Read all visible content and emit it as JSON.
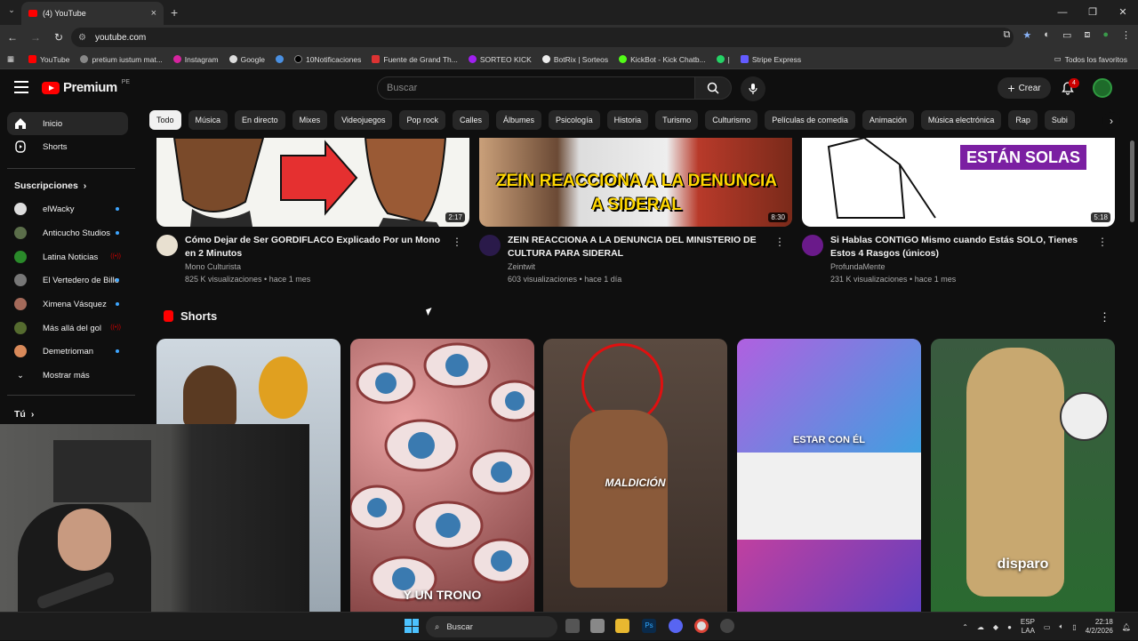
{
  "browser": {
    "tab_title": "(4) YouTube",
    "url": "youtube.com",
    "bookmarks": [
      "YouTube",
      "pretium iustum mat...",
      "Instagram",
      "Google",
      "",
      "10Notificaciones",
      "Fuente de Grand Th...",
      "SORTEO KICK",
      "BotRix | Sorteos",
      "KickBot - Kick Chatb...",
      "|",
      "Stripe Express"
    ],
    "all_bookmarks": "Todos los favoritos"
  },
  "header": {
    "logo_text": "Premium",
    "logo_region": "PE",
    "search_placeholder": "Buscar",
    "create_label": "Crear",
    "notif_count": "4"
  },
  "sidebar": {
    "home": "Inicio",
    "shorts": "Shorts",
    "subs_title": "Suscripciones",
    "channels": [
      {
        "name": "elWacky",
        "status": "new"
      },
      {
        "name": "Anticucho Studios",
        "status": "new"
      },
      {
        "name": "Latina Noticias",
        "status": "live"
      },
      {
        "name": "El Vertedero de Billo",
        "status": "new"
      },
      {
        "name": "Ximena Vásquez",
        "status": "new"
      },
      {
        "name": "Más allá del gol",
        "status": "live"
      },
      {
        "name": "Demetrioman",
        "status": "new"
      }
    ],
    "show_more": "Mostrar más",
    "you_title": "Tú"
  },
  "chips": [
    "Todo",
    "Música",
    "En directo",
    "Mixes",
    "Videojuegos",
    "Pop rock",
    "Calles",
    "Álbumes",
    "Psicología",
    "Historia",
    "Turismo",
    "Culturismo",
    "Películas de comedia",
    "Animación",
    "Música electrónica",
    "Rap",
    "Subi"
  ],
  "videos": [
    {
      "title": "Cómo Dejar de Ser GORDIFLACO Explicado Por un Mono en 2 Minutos",
      "channel": "Mono Culturista",
      "meta": "825 K visualizaciones • hace 1 mes",
      "duration": "2:17"
    },
    {
      "title": "ZEIN REACCIONA A LA DENUNCIA DEL MINISTERIO DE CULTURA PARA SIDERAL",
      "channel": "Zeintwit",
      "meta": "603 visualizaciones • hace 1 día",
      "duration": "8:30",
      "thumb_text": "ZEIN REACCIONA A LA DENUNCIA A SIDERAL"
    },
    {
      "title": "Si Hablas CONTIGO Mismo cuando Estás SOLO, Tienes Estos 4 Rasgos (únicos)",
      "channel": "ProfundaMente",
      "meta": "231 K visualizaciones • hace 1 mes",
      "duration": "5:18",
      "thumb_text": "ESTÁN SOLAS"
    }
  ],
  "shorts_section": {
    "title": "Shorts",
    "items": [
      {
        "caption": ""
      },
      {
        "caption": "Y UN TRONO"
      },
      {
        "caption": "MALDICIÓN"
      },
      {
        "caption": "ESTAR CON ÉL"
      },
      {
        "caption": "disparo"
      }
    ]
  },
  "taskbar": {
    "search": "Buscar",
    "lang1": "ESP",
    "lang2": "LAA",
    "time": "22:18",
    "date": "4/2/2026"
  },
  "colors": {
    "accent": "#ff0000",
    "link": "#3ea6ff",
    "bg": "#0f0f0f"
  }
}
